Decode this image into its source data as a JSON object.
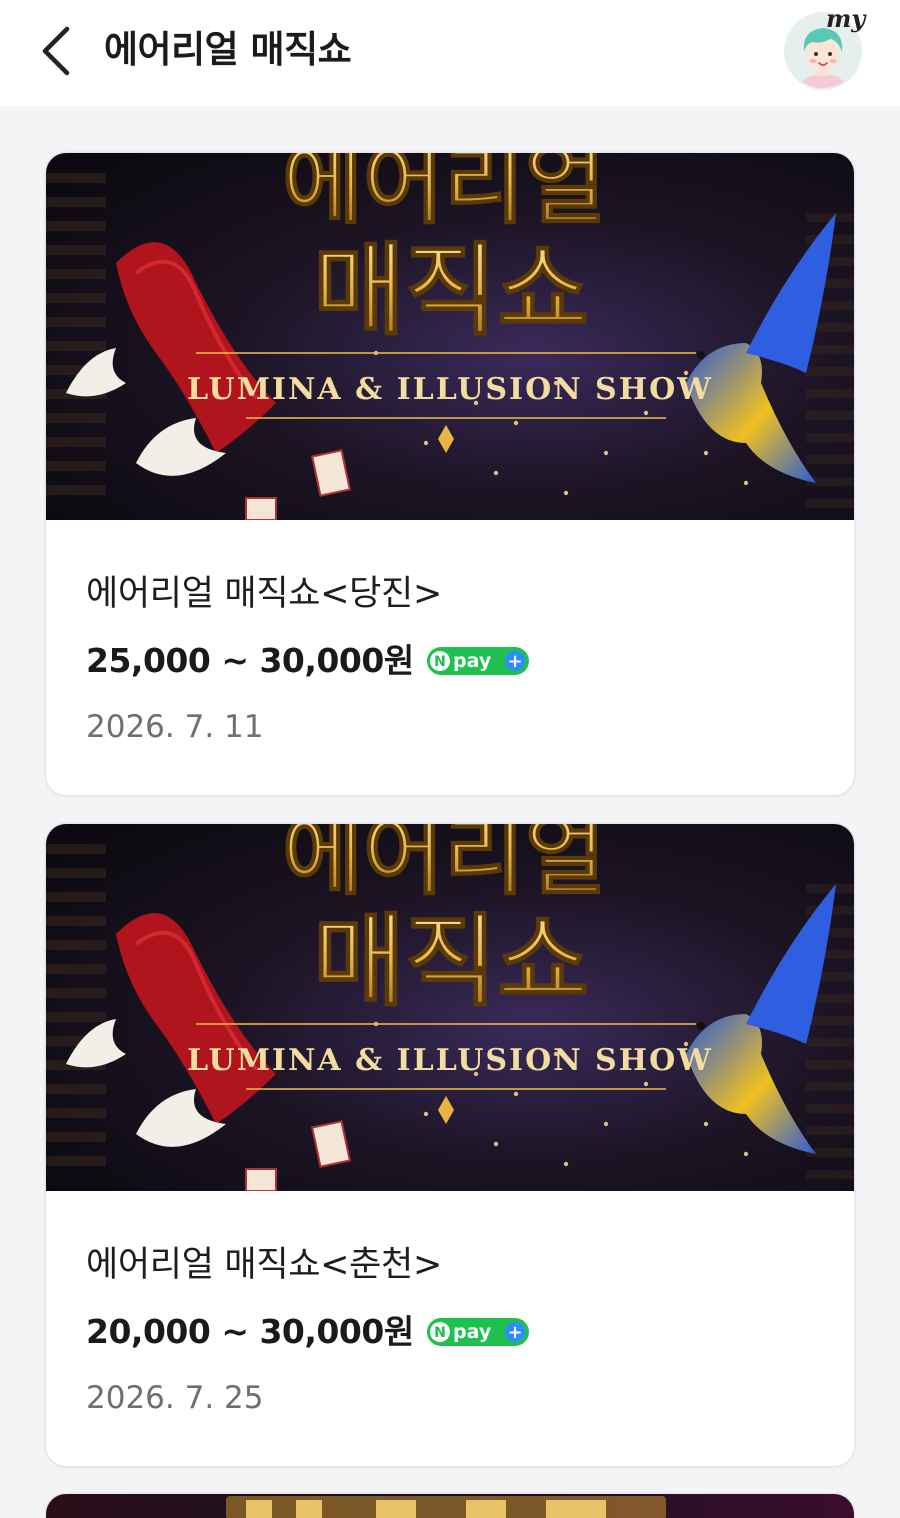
{
  "header": {
    "title": "에어리얼 매직쇼",
    "my_label": "my"
  },
  "npay": {
    "label": "pay",
    "n": "N",
    "plus": "+"
  },
  "colors": {
    "npay_green": "#1ec14f",
    "npay_blue": "#2f8cff",
    "price_text": "#1a1a1a",
    "date_text": "#6f6f6f",
    "poster_gold": "#e8b545"
  },
  "events": [
    {
      "poster": {
        "title_line1": "에어리얼",
        "title_line2": "매직쇼",
        "subtitle": "LUMINA & ILLUSION SHOW"
      },
      "title": "에어리얼 매직쇼<당진>",
      "price": "25,000 ~ 30,000원",
      "date": "2026. 7. 11"
    },
    {
      "poster": {
        "title_line1": "에어리얼",
        "title_line2": "매직쇼",
        "subtitle": "LUMINA & ILLUSION SHOW"
      },
      "title": "에어리얼 매직쇼<춘천>",
      "price": "20,000 ~ 30,000원",
      "date": "2026. 7. 25"
    }
  ]
}
